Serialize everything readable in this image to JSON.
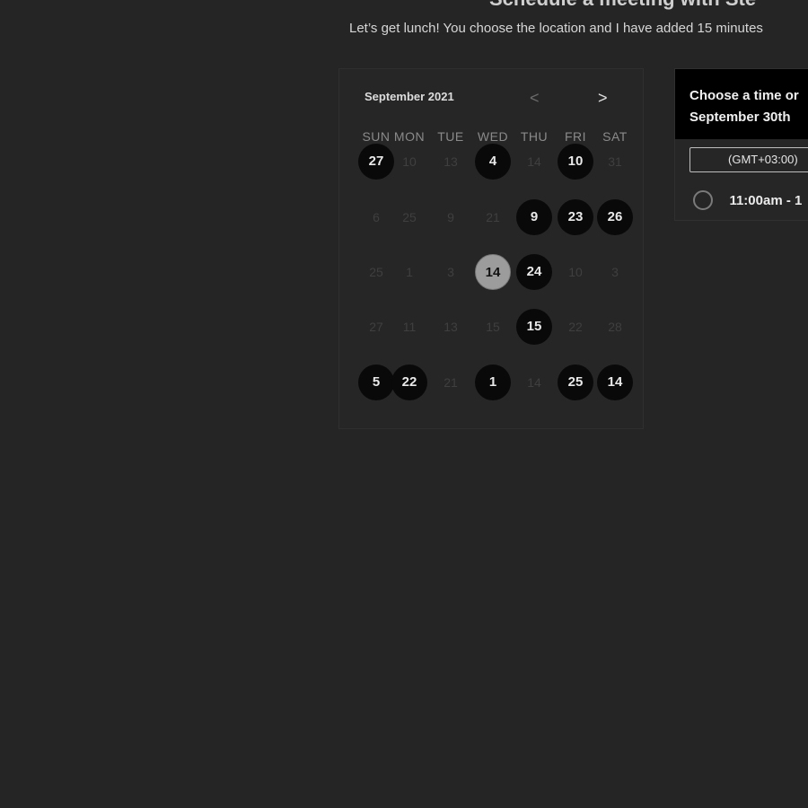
{
  "header": {
    "title": "Schedule a meeting with Ste",
    "subtitle": "Let’s get lunch! You choose the location and I have added 15 minutes"
  },
  "calendar": {
    "month_label": "September 2021",
    "prev_icon": "chevron-left-icon",
    "next_icon": "chevron-right-icon",
    "prev_glyph": "<",
    "next_glyph": ">",
    "weekdays": [
      "SUN",
      "MON",
      "TUE",
      "WED",
      "THU",
      "FRI",
      "SAT"
    ],
    "weeks": [
      [
        {
          "label": "27",
          "state": "available"
        },
        {
          "label": "10",
          "state": "muted"
        },
        {
          "label": "13",
          "state": "muted"
        },
        {
          "label": "4",
          "state": "available"
        },
        {
          "label": "14",
          "state": "muted"
        },
        {
          "label": "10",
          "state": "available"
        },
        {
          "label": "31",
          "state": "muted"
        }
      ],
      [
        {
          "label": "6",
          "state": "muted"
        },
        {
          "label": "25",
          "state": "muted"
        },
        {
          "label": "9",
          "state": "muted"
        },
        {
          "label": "21",
          "state": "muted"
        },
        {
          "label": "9",
          "state": "available"
        },
        {
          "label": "23",
          "state": "available"
        },
        {
          "label": "26",
          "state": "available"
        }
      ],
      [
        {
          "label": "25",
          "state": "muted"
        },
        {
          "label": "1",
          "state": "muted"
        },
        {
          "label": "3",
          "state": "muted"
        },
        {
          "label": "14",
          "state": "selected"
        },
        {
          "label": "24",
          "state": "available"
        },
        {
          "label": "10",
          "state": "muted"
        },
        {
          "label": "3",
          "state": "muted"
        }
      ],
      [
        {
          "label": "27",
          "state": "muted"
        },
        {
          "label": "11",
          "state": "muted"
        },
        {
          "label": "13",
          "state": "muted"
        },
        {
          "label": "15",
          "state": "muted"
        },
        {
          "label": "15",
          "state": "available"
        },
        {
          "label": "22",
          "state": "muted"
        },
        {
          "label": "28",
          "state": "muted"
        }
      ],
      [
        {
          "label": "5",
          "state": "available"
        },
        {
          "label": "22",
          "state": "available"
        },
        {
          "label": "21",
          "state": "muted"
        },
        {
          "label": "1",
          "state": "available"
        },
        {
          "label": "14",
          "state": "muted"
        },
        {
          "label": "25",
          "state": "available"
        },
        {
          "label": "14",
          "state": "available"
        }
      ]
    ]
  },
  "time_panel": {
    "heading_line1": "Choose a time or",
    "heading_line2": "September 30th",
    "timezone": "(GMT+03:00)",
    "slots": [
      {
        "label": "11:00am - 1",
        "selected": false
      }
    ]
  },
  "colors": {
    "background": "#252525",
    "available_day": "#090909",
    "selected_day": "#9c9c9c"
  }
}
